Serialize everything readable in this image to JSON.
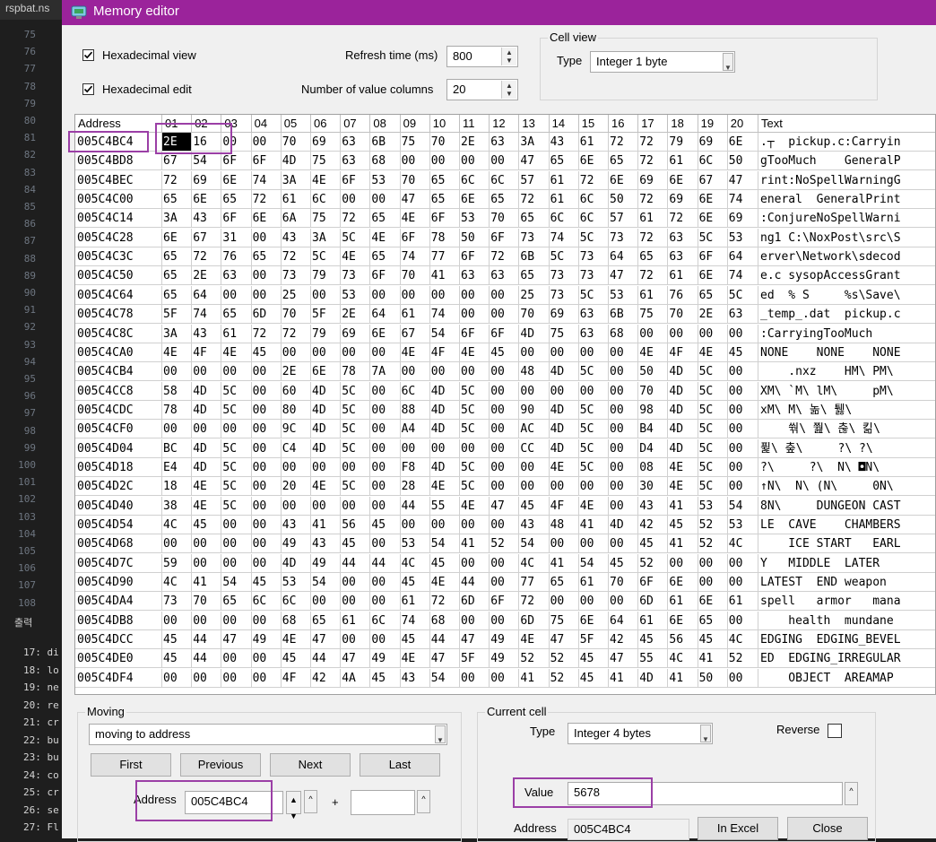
{
  "background": {
    "tab": "rspbat.ns",
    "line_numbers": [
      "75",
      "76",
      "77",
      "78",
      "79",
      "80",
      "81",
      "82",
      "83",
      "84",
      "85",
      "86",
      "87",
      "88",
      "89",
      "90",
      "91",
      "92",
      "93",
      "94",
      "95",
      "96",
      "97",
      "98",
      "99",
      "100",
      "101",
      "102",
      "103",
      "104",
      "105",
      "106",
      "107",
      "108"
    ],
    "output_label": "출력",
    "output_lines": [
      "17: di",
      "18: lo",
      "19: ne",
      "20: re",
      "21: cr",
      "22: bu",
      "23: bu",
      "24: co",
      "25: cr",
      "26: se",
      "27: Fl"
    ]
  },
  "window": {
    "title": "Memory editor",
    "accent_color": "#9b239b"
  },
  "options": {
    "hex_view_label": "Hexadecimal view",
    "hex_view_checked": true,
    "hex_edit_label": "Hexadecimal edit",
    "hex_edit_checked": true,
    "refresh_label": "Refresh time (ms)",
    "refresh_value": "800",
    "columns_label": "Number of value columns",
    "columns_value": "20"
  },
  "cell_view": {
    "group_title": "Cell view",
    "type_label": "Type",
    "type_value": "Integer 1 byte"
  },
  "grid": {
    "headers": [
      "Address",
      "01",
      "02",
      "03",
      "04",
      "05",
      "06",
      "07",
      "08",
      "09",
      "10",
      "11",
      "12",
      "13",
      "14",
      "15",
      "16",
      "17",
      "18",
      "19",
      "20",
      "Text"
    ],
    "rows": [
      {
        "addr": "005C4BC4",
        "bytes": [
          "2E",
          "16",
          "00",
          "00",
          "70",
          "69",
          "63",
          "6B",
          "75",
          "70",
          "2E",
          "63",
          "3A",
          "43",
          "61",
          "72",
          "72",
          "79",
          "69",
          "6E"
        ],
        "text": ".┬  pickup.c:Carryin"
      },
      {
        "addr": "005C4BD8",
        "bytes": [
          "67",
          "54",
          "6F",
          "6F",
          "4D",
          "75",
          "63",
          "68",
          "00",
          "00",
          "00",
          "00",
          "47",
          "65",
          "6E",
          "65",
          "72",
          "61",
          "6C",
          "50"
        ],
        "text": "gTooMuch    GeneralP"
      },
      {
        "addr": "005C4BEC",
        "bytes": [
          "72",
          "69",
          "6E",
          "74",
          "3A",
          "4E",
          "6F",
          "53",
          "70",
          "65",
          "6C",
          "6C",
          "57",
          "61",
          "72",
          "6E",
          "69",
          "6E",
          "67",
          "47"
        ],
        "text": "rint:NoSpellWarningG"
      },
      {
        "addr": "005C4C00",
        "bytes": [
          "65",
          "6E",
          "65",
          "72",
          "61",
          "6C",
          "00",
          "00",
          "47",
          "65",
          "6E",
          "65",
          "72",
          "61",
          "6C",
          "50",
          "72",
          "69",
          "6E",
          "74"
        ],
        "text": "eneral  GeneralPrint"
      },
      {
        "addr": "005C4C14",
        "bytes": [
          "3A",
          "43",
          "6F",
          "6E",
          "6A",
          "75",
          "72",
          "65",
          "4E",
          "6F",
          "53",
          "70",
          "65",
          "6C",
          "6C",
          "57",
          "61",
          "72",
          "6E",
          "69"
        ],
        "text": ":ConjureNoSpellWarni"
      },
      {
        "addr": "005C4C28",
        "bytes": [
          "6E",
          "67",
          "31",
          "00",
          "43",
          "3A",
          "5C",
          "4E",
          "6F",
          "78",
          "50",
          "6F",
          "73",
          "74",
          "5C",
          "73",
          "72",
          "63",
          "5C",
          "53"
        ],
        "text": "ng1 C:\\NoxPost\\src\\S"
      },
      {
        "addr": "005C4C3C",
        "bytes": [
          "65",
          "72",
          "76",
          "65",
          "72",
          "5C",
          "4E",
          "65",
          "74",
          "77",
          "6F",
          "72",
          "6B",
          "5C",
          "73",
          "64",
          "65",
          "63",
          "6F",
          "64"
        ],
        "text": "erver\\Network\\sdecod"
      },
      {
        "addr": "005C4C50",
        "bytes": [
          "65",
          "2E",
          "63",
          "00",
          "73",
          "79",
          "73",
          "6F",
          "70",
          "41",
          "63",
          "63",
          "65",
          "73",
          "73",
          "47",
          "72",
          "61",
          "6E",
          "74"
        ],
        "text": "e.c sysopAccessGrant"
      },
      {
        "addr": "005C4C64",
        "bytes": [
          "65",
          "64",
          "00",
          "00",
          "25",
          "00",
          "53",
          "00",
          "00",
          "00",
          "00",
          "00",
          "25",
          "73",
          "5C",
          "53",
          "61",
          "76",
          "65",
          "5C"
        ],
        "text": "ed  % S     %s\\Save\\"
      },
      {
        "addr": "005C4C78",
        "bytes": [
          "5F",
          "74",
          "65",
          "6D",
          "70",
          "5F",
          "2E",
          "64",
          "61",
          "74",
          "00",
          "00",
          "70",
          "69",
          "63",
          "6B",
          "75",
          "70",
          "2E",
          "63"
        ],
        "text": "_temp_.dat  pickup.c"
      },
      {
        "addr": "005C4C8C",
        "bytes": [
          "3A",
          "43",
          "61",
          "72",
          "72",
          "79",
          "69",
          "6E",
          "67",
          "54",
          "6F",
          "6F",
          "4D",
          "75",
          "63",
          "68",
          "00",
          "00",
          "00",
          "00"
        ],
        "text": ":CarryingTooMuch"
      },
      {
        "addr": "005C4CA0",
        "bytes": [
          "4E",
          "4F",
          "4E",
          "45",
          "00",
          "00",
          "00",
          "00",
          "4E",
          "4F",
          "4E",
          "45",
          "00",
          "00",
          "00",
          "00",
          "4E",
          "4F",
          "4E",
          "45"
        ],
        "text": "NONE    NONE    NONE"
      },
      {
        "addr": "005C4CB4",
        "bytes": [
          "00",
          "00",
          "00",
          "00",
          "2E",
          "6E",
          "78",
          "7A",
          "00",
          "00",
          "00",
          "00",
          "48",
          "4D",
          "5C",
          "00",
          "50",
          "4D",
          "5C",
          "00"
        ],
        "text": "    .nxz    HM\\ PM\\"
      },
      {
        "addr": "005C4CC8",
        "bytes": [
          "58",
          "4D",
          "5C",
          "00",
          "60",
          "4D",
          "5C",
          "00",
          "6C",
          "4D",
          "5C",
          "00",
          "00",
          "00",
          "00",
          "00",
          "70",
          "4D",
          "5C",
          "00"
        ],
        "text": "XM\\ `M\\ lM\\     pM\\"
      },
      {
        "addr": "005C4CDC",
        "bytes": [
          "78",
          "4D",
          "5C",
          "00",
          "80",
          "4D",
          "5C",
          "00",
          "88",
          "4D",
          "5C",
          "00",
          "90",
          "4D",
          "5C",
          "00",
          "98",
          "4D",
          "5C",
          "00"
        ],
        "text": "xM\\ M\\ 놂\\ 퉳\\"
      },
      {
        "addr": "005C4CF0",
        "bytes": [
          "00",
          "00",
          "00",
          "00",
          "9C",
          "4D",
          "5C",
          "00",
          "A4",
          "4D",
          "5C",
          "00",
          "AC",
          "4D",
          "5C",
          "00",
          "B4",
          "4D",
          "5C",
          "00"
        ],
        "text": "    쒂\\ 쭲\\ 춚\\ 킮\\"
      },
      {
        "addr": "005C4D04",
        "bytes": [
          "BC",
          "4D",
          "5C",
          "00",
          "C4",
          "4D",
          "5C",
          "00",
          "00",
          "00",
          "00",
          "00",
          "CC",
          "4D",
          "5C",
          "00",
          "D4",
          "4D",
          "5C",
          "00"
        ],
        "text": "퓙\\ 춮\\     ?\\ ?\\"
      },
      {
        "addr": "005C4D18",
        "bytes": [
          "E4",
          "4D",
          "5C",
          "00",
          "00",
          "00",
          "00",
          "00",
          "F8",
          "4D",
          "5C",
          "00",
          "00",
          "4E",
          "5C",
          "00",
          "08",
          "4E",
          "5C",
          "00"
        ],
        "text": "?\\     ?\\  N\\ ◘N\\"
      },
      {
        "addr": "005C4D2C",
        "bytes": [
          "18",
          "4E",
          "5C",
          "00",
          "20",
          "4E",
          "5C",
          "00",
          "28",
          "4E",
          "5C",
          "00",
          "00",
          "00",
          "00",
          "00",
          "30",
          "4E",
          "5C",
          "00"
        ],
        "text": "↑N\\  N\\ (N\\     0N\\"
      },
      {
        "addr": "005C4D40",
        "bytes": [
          "38",
          "4E",
          "5C",
          "00",
          "00",
          "00",
          "00",
          "00",
          "44",
          "55",
          "4E",
          "47",
          "45",
          "4F",
          "4E",
          "00",
          "43",
          "41",
          "53",
          "54"
        ],
        "text": "8N\\     DUNGEON CAST"
      },
      {
        "addr": "005C4D54",
        "bytes": [
          "4C",
          "45",
          "00",
          "00",
          "43",
          "41",
          "56",
          "45",
          "00",
          "00",
          "00",
          "00",
          "43",
          "48",
          "41",
          "4D",
          "42",
          "45",
          "52",
          "53"
        ],
        "text": "LE  CAVE    CHAMBERS"
      },
      {
        "addr": "005C4D68",
        "bytes": [
          "00",
          "00",
          "00",
          "00",
          "49",
          "43",
          "45",
          "00",
          "53",
          "54",
          "41",
          "52",
          "54",
          "00",
          "00",
          "00",
          "45",
          "41",
          "52",
          "4C"
        ],
        "text": "    ICE START   EARL"
      },
      {
        "addr": "005C4D7C",
        "bytes": [
          "59",
          "00",
          "00",
          "00",
          "4D",
          "49",
          "44",
          "44",
          "4C",
          "45",
          "00",
          "00",
          "4C",
          "41",
          "54",
          "45",
          "52",
          "00",
          "00",
          "00"
        ],
        "text": "Y   MIDDLE  LATER"
      },
      {
        "addr": "005C4D90",
        "bytes": [
          "4C",
          "41",
          "54",
          "45",
          "53",
          "54",
          "00",
          "00",
          "45",
          "4E",
          "44",
          "00",
          "77",
          "65",
          "61",
          "70",
          "6F",
          "6E",
          "00",
          "00"
        ],
        "text": "LATEST  END weapon"
      },
      {
        "addr": "005C4DA4",
        "bytes": [
          "73",
          "70",
          "65",
          "6C",
          "6C",
          "00",
          "00",
          "00",
          "61",
          "72",
          "6D",
          "6F",
          "72",
          "00",
          "00",
          "00",
          "6D",
          "61",
          "6E",
          "61"
        ],
        "text": "spell   armor   mana"
      },
      {
        "addr": "005C4DB8",
        "bytes": [
          "00",
          "00",
          "00",
          "00",
          "68",
          "65",
          "61",
          "6C",
          "74",
          "68",
          "00",
          "00",
          "6D",
          "75",
          "6E",
          "64",
          "61",
          "6E",
          "65",
          "00"
        ],
        "text": "    health  mundane"
      },
      {
        "addr": "005C4DCC",
        "bytes": [
          "45",
          "44",
          "47",
          "49",
          "4E",
          "47",
          "00",
          "00",
          "45",
          "44",
          "47",
          "49",
          "4E",
          "47",
          "5F",
          "42",
          "45",
          "56",
          "45",
          "4C"
        ],
        "text": "EDGING  EDGING_BEVEL"
      },
      {
        "addr": "005C4DE0",
        "bytes": [
          "45",
          "44",
          "00",
          "00",
          "45",
          "44",
          "47",
          "49",
          "4E",
          "47",
          "5F",
          "49",
          "52",
          "52",
          "45",
          "47",
          "55",
          "4C",
          "41",
          "52"
        ],
        "text": "ED  EDGING_IRREGULAR"
      },
      {
        "addr": "005C4DF4",
        "bytes": [
          "00",
          "00",
          "00",
          "00",
          "4F",
          "42",
          "4A",
          "45",
          "43",
          "54",
          "00",
          "00",
          "41",
          "52",
          "45",
          "41",
          "4D",
          "41",
          "50",
          "00"
        ],
        "text": "    OBJECT  AREAMAP"
      }
    ]
  },
  "moving": {
    "group_title": "Moving",
    "mode_value": "moving to address",
    "first_label": "First",
    "previous_label": "Previous",
    "next_label": "Next",
    "last_label": "Last",
    "address_label": "Address",
    "address_value": "005C4BC4",
    "plus_label": "+",
    "offset_value": ""
  },
  "current_cell": {
    "group_title": "Current cell",
    "type_label": "Type",
    "type_value": "Integer 4 bytes",
    "reverse_label": "Reverse",
    "reverse_checked": false,
    "value_label": "Value",
    "value_value": "5678",
    "address_label": "Address",
    "address_value": "005C4BC4",
    "in_excel_label": "In Excel",
    "close_label": "Close"
  },
  "highlight_color": "#9b3fa6"
}
